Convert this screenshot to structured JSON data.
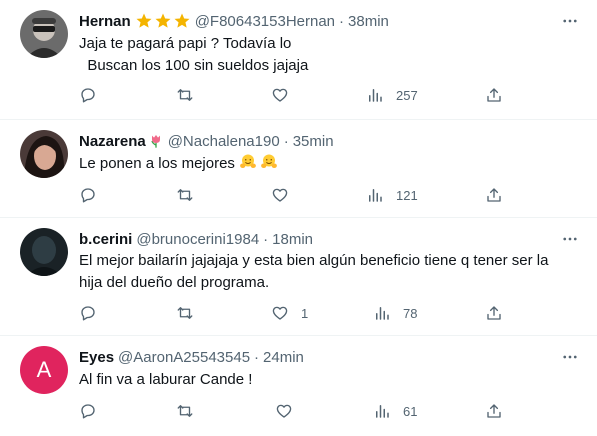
{
  "tweets": [
    {
      "name": "Hernan",
      "handle": "@F80643153Hernan",
      "dot": "·",
      "time": "38min",
      "text_lines": [
        "Jaja te pagará papi ? Todavía lo",
        "  Buscan los 100 sin sueldos jajaja"
      ],
      "avatar": "photo",
      "stats": {
        "replies": "",
        "retweets": "",
        "likes": "",
        "views": "257"
      }
    },
    {
      "name": "Nazarena",
      "handle": "@Nachalena190",
      "dot": "·",
      "time": "35min",
      "text_lines": [
        "Le ponen a los mejores"
      ],
      "avatar": "photo",
      "stats": {
        "replies": "",
        "retweets": "",
        "likes": "",
        "views": "121"
      }
    },
    {
      "name": "b.cerini",
      "handle": "@brunocerini1984",
      "dot": "·",
      "time": "18min",
      "text_lines": [
        "El mejor bailarín jajajaja y esta bien algún beneficio tiene q tener ser la",
        "hija del dueño del programa."
      ],
      "avatar": "photo",
      "stats": {
        "replies": "",
        "retweets": "",
        "likes": "1",
        "views": "78"
      }
    },
    {
      "name": "Eyes",
      "handle": "@AaronA25543545",
      "dot": "·",
      "time": "24min",
      "text_lines": [
        "Al fin va a laburar Cande !"
      ],
      "avatar": "letter",
      "avatar_letter": "A",
      "stats": {
        "replies": "",
        "retweets": "",
        "likes": "",
        "views": "61"
      }
    }
  ],
  "icons": {
    "reply": "reply-icon",
    "retweet": "retweet-icon",
    "like": "like-icon",
    "views": "views-icon",
    "share": "share-icon",
    "more": "more-icon",
    "star": "star-icon",
    "tulip": "tulip-icon",
    "hug_emoji": "hugging-face-emoji"
  },
  "colors": {
    "text": "#0f1419",
    "secondary": "#536471",
    "divider": "#eff3f4",
    "star": "#f4b400",
    "avatar_letter_bg": "#e0245e"
  }
}
